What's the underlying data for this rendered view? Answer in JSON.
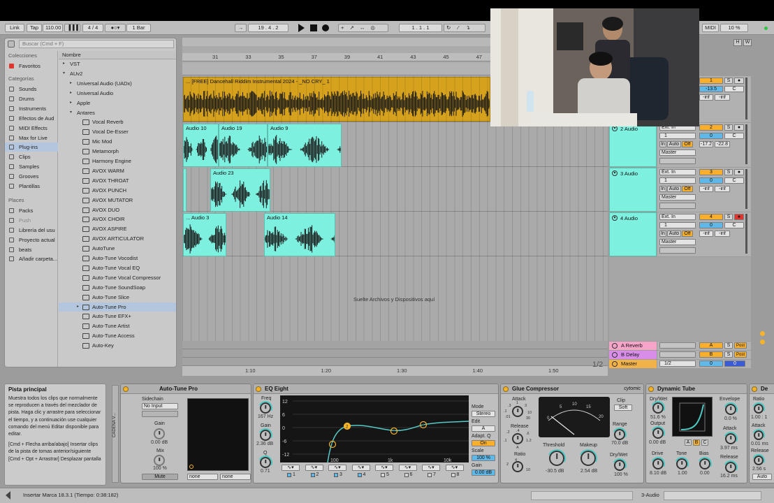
{
  "transport": {
    "link": "Link",
    "tap": "Tap",
    "tempo": "110.00",
    "signature": "4 / 4",
    "quantize": "1 Bar",
    "position": "19 .  4 .  2",
    "loop_start": "1 .  1 .  1",
    "midi": "MIDI",
    "cpu": "10 %"
  },
  "browser": {
    "search_placeholder": "Buscar (Cmd + F)",
    "collections_header": "Colecciones",
    "favorites": "Favoritos",
    "categories_header": "Categorías",
    "categories": [
      "Sounds",
      "Drums",
      "Instruments",
      "Efectos de Aud",
      "MIDI Effects",
      "Max for Live",
      "Plug-ins",
      "Clips",
      "Samples",
      "Grooves",
      "Plantillas"
    ],
    "places_header": "Places",
    "places": [
      "Packs",
      "Push",
      "Librería del usu",
      "Proyecto actual",
      "beats",
      "Añadir carpeta..."
    ],
    "name_header": "Nombre",
    "tree": [
      {
        "label": "VST",
        "level": 1
      },
      {
        "label": "AUv2",
        "level": 1,
        "open": true
      },
      {
        "label": "Universal Audio (UADx)",
        "level": 2
      },
      {
        "label": "Universal Audio",
        "level": 2
      },
      {
        "label": "Apple",
        "level": 2
      },
      {
        "label": "Antares",
        "level": 2,
        "open": true
      },
      {
        "label": "Vocal Reverb",
        "level": 3
      },
      {
        "label": "Vocal De-Esser",
        "level": 3
      },
      {
        "label": "Mic Mod",
        "level": 3
      },
      {
        "label": "Metamorph",
        "level": 3
      },
      {
        "label": "Harmony Engine",
        "level": 3
      },
      {
        "label": "AVOX WARM",
        "level": 3
      },
      {
        "label": "AVOX THROAT",
        "level": 3
      },
      {
        "label": "AVOX PUNCH",
        "level": 3
      },
      {
        "label": "AVOX MUTATOR",
        "level": 3
      },
      {
        "label": "AVOX DUO",
        "level": 3
      },
      {
        "label": "AVOX CHOIR",
        "level": 3
      },
      {
        "label": "AVOX ASPIRE",
        "level": 3
      },
      {
        "label": "AVOX ARTICULATOR",
        "level": 3
      },
      {
        "label": "AutoTune",
        "level": 3
      },
      {
        "label": "Auto-Tune Vocodist",
        "level": 3
      },
      {
        "label": "Auto-Tune Vocal EQ",
        "level": 3
      },
      {
        "label": "Auto-Tune Vocal Compressor",
        "level": 3
      },
      {
        "label": "Auto-Tune SoundSoap",
        "level": 3
      },
      {
        "label": "Auto-Tune Slice",
        "level": 3
      },
      {
        "label": "Auto-Tune Pro",
        "level": 3,
        "selected": true
      },
      {
        "label": "Auto-Tune EFX+",
        "level": 3
      },
      {
        "label": "Auto-Tune Artist",
        "level": 3
      },
      {
        "label": "Auto-Tune Access",
        "level": 3
      },
      {
        "label": "Auto-Key",
        "level": 3
      }
    ]
  },
  "arrangement": {
    "ruler_bars": [
      "31",
      "33",
      "35",
      "37",
      "39",
      "41",
      "43",
      "45",
      "47"
    ],
    "time_marks": [
      "1:10",
      "1:20",
      "1:30",
      "1:40",
      "1:50"
    ],
    "page": "1/2",
    "drop_text": "Suelte Archivos y Dispositivos aquí",
    "beat_clip": "... [FREE] Dancehall Riddim Instrumental 2024 - _NO CRY_ 1",
    "clips": [
      {
        "track": 2,
        "name": "Audio 10"
      },
      {
        "track": 2,
        "name": "Audio 19"
      },
      {
        "track": 2,
        "name": "Audio 9"
      },
      {
        "track": 3,
        "name": "Audio 23"
      },
      {
        "track": 4,
        "name": "... Audio 3"
      },
      {
        "track": 4,
        "name": "Audio 14"
      }
    ]
  },
  "tracks": [
    {
      "name": "",
      "number": "1",
      "vol": "-13.5",
      "pan": "C",
      "peak1": "-inf",
      "peak2": "-inf"
    },
    {
      "name": "2 Audio",
      "number": "2",
      "input": "Ext. In",
      "channel": "1",
      "monitor": [
        "In",
        "Auto",
        "Off"
      ],
      "output": "Master",
      "vol": "0",
      "pan": "C",
      "peak1": "-17.2",
      "peak2": "-22.8"
    },
    {
      "name": "3 Audio",
      "number": "3",
      "input": "Ext. In",
      "channel": "1",
      "monitor": [
        "In",
        "Auto",
        "Off"
      ],
      "output": "Master",
      "vol": "0",
      "pan": "C",
      "peak1": "-inf",
      "peak2": "-inf"
    },
    {
      "name": "4 Audio",
      "number": "4",
      "input": "Ext. In",
      "channel": "1",
      "monitor": [
        "In",
        "Auto",
        "Off"
      ],
      "output": "Master",
      "vol": "0",
      "pan": "C",
      "peak1": "-inf",
      "peak2": "-inf"
    }
  ],
  "returns": [
    {
      "name": "A Reverb",
      "letter": "A",
      "color": "#f7a4c9"
    },
    {
      "name": "B Delay",
      "letter": "B",
      "color": "#d88ee8"
    },
    {
      "name": "Master",
      "letter": "",
      "color": "#f2b24a",
      "output": "1/2"
    }
  ],
  "info": {
    "title": "Pista principal",
    "text": "Muestra todos los clips que normalmente se reproducen a través del mezclador de pista. Haga clic y arrastre para seleccionar el tiempo, y a continuación use cualquier comando del menú Editar disponible para editar.",
    "text2": "[Cmd + Flecha arriba/abajo] Insertar clips de la pista de tomas anterior/siguiente",
    "text3": "[Cmd + Opt + Arrastrar] Desplazar pantalla"
  },
  "chain_label": "CADENA V...",
  "devices": {
    "autotune": {
      "title": "Auto-Tune Pro",
      "sidechain": "Sidechain",
      "input": "No Input",
      "gain_label": "Gain",
      "gain": "0.00 dB",
      "mix_label": "Mix",
      "mix": "100 %",
      "mute": "Mute",
      "sel1": "none",
      "sel2": "none"
    },
    "eq": {
      "title": "EQ Eight",
      "freq_label": "Freq",
      "freq": "167 Hz",
      "gain_label": "Gain",
      "gain": "2.36 dB",
      "q_label": "Q",
      "q": "0.71",
      "mode_label": "Mode",
      "mode": "Stereo",
      "edit_label": "Edit",
      "edit": "A",
      "adapt_label": "Adapt. Q",
      "adapt": "On",
      "scale_label": "Scale",
      "scale": "100 %",
      "gain_out_label": "Gain",
      "gain_out": "0.00 dB",
      "y_ticks": [
        "12",
        "6",
        "0",
        "-6",
        "-12"
      ],
      "x_ticks": [
        "100",
        "1k",
        "10k"
      ],
      "bands": [
        "1",
        "2",
        "3",
        "4",
        "5",
        "6",
        "7",
        "8"
      ],
      "points": [
        "1",
        "2",
        "3",
        "4"
      ]
    },
    "glue": {
      "title": "Glue Compressor",
      "attack_label": "Attack",
      "release_label": "Release",
      "ratio_label": "Ratio",
      "threshold_label": "Threshold",
      "threshold": "-30.5 dB",
      "makeup_label": "Makeup",
      "makeup": "2.54 dB",
      "clip_label": "Clip",
      "soft": "Soft",
      "range_label": "Range",
      "range": "70.0 dB",
      "drywet_label": "Dry/Wet",
      "drywet": "100 %",
      "brand": "cytomic",
      "meter_ticks": [
        "0",
        "5",
        "10",
        "15",
        "20"
      ],
      "attack_ticks": [
        ".3",
        "1",
        "3",
        "10",
        "30",
        ".1",
        ".01"
      ],
      "release_ticks": [
        ".2",
        ".4",
        ".6",
        "1.2",
        ".1",
        "A"
      ],
      "ratio_ticks": [
        "2",
        "4",
        "10"
      ]
    },
    "tube": {
      "title": "Dynamic Tube",
      "drywet_label": "Dry/Wet",
      "drywet": "51.6 %",
      "output_label": "Output",
      "output": "0.00 dB",
      "drive_label": "Drive",
      "drive": "8.10 dB",
      "tone_label": "Tone",
      "tone": "1.00",
      "bias_label": "Bias",
      "bias": "0.00",
      "envelope_label": "Envelope",
      "envelope": "0.0 %",
      "attack_label": "Attack",
      "attack": "3.97 ms",
      "release_label": "Release",
      "release": "16.2 ms",
      "abc": [
        "A",
        "B",
        "C"
      ]
    },
    "next": {
      "title": "De",
      "ratio_label": "Ratio",
      "ratio": "1.00 : 1",
      "attack_label": "Attack",
      "attack": "0.01 ms",
      "release_label": "Release",
      "release": "2.56 s",
      "auto": "Auto"
    }
  },
  "status": {
    "text": "Insertar Marca 18.3.1 (Tiempo: 0:38:182)",
    "track": "3-Audio"
  }
}
